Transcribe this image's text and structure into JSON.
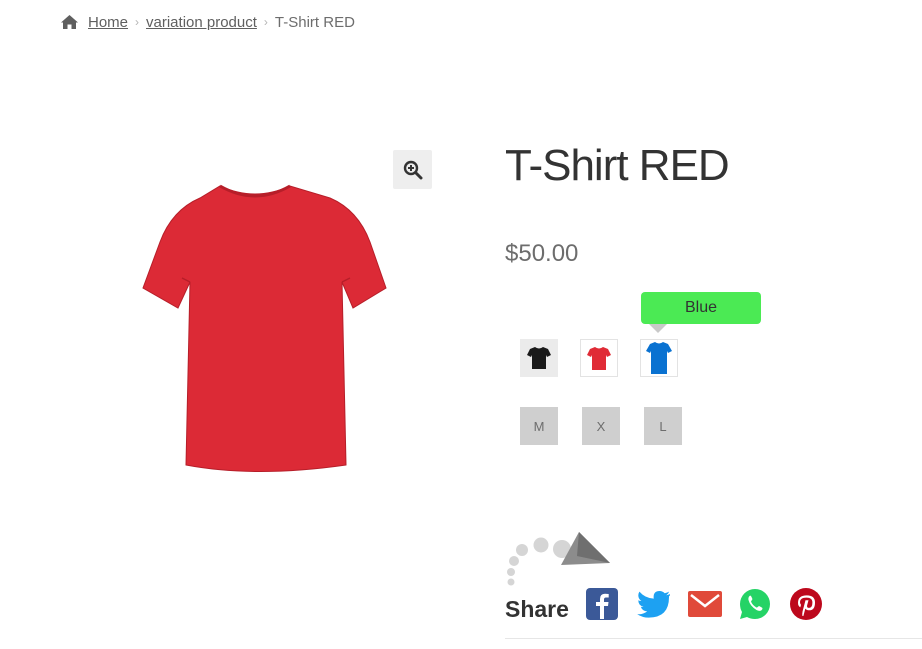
{
  "breadcrumb": {
    "home_label": "Home",
    "category_label": "variation product",
    "current_label": "T-Shirt RED"
  },
  "product": {
    "title": "T-Shirt RED",
    "price": "$50.00",
    "image_color": "#dc2a36"
  },
  "tooltip": {
    "label": "Blue",
    "color": "#4bea54"
  },
  "color_swatches": [
    {
      "name": "Black",
      "color": "#1a1a1a"
    },
    {
      "name": "Red",
      "color": "#e02b36"
    },
    {
      "name": "Blue",
      "color": "#0a72d1"
    }
  ],
  "sizes": [
    {
      "label": "M"
    },
    {
      "label": "X"
    },
    {
      "label": "L"
    }
  ],
  "share": {
    "label": "Share",
    "icons": [
      "facebook-icon",
      "twitter-icon",
      "email-icon",
      "whatsapp-icon",
      "pinterest-icon"
    ],
    "colors": {
      "facebook": "#3b5998",
      "twitter": "#1da1f2",
      "email": "#e04a3a",
      "whatsapp": "#25d366",
      "pinterest": "#bd081c"
    }
  }
}
